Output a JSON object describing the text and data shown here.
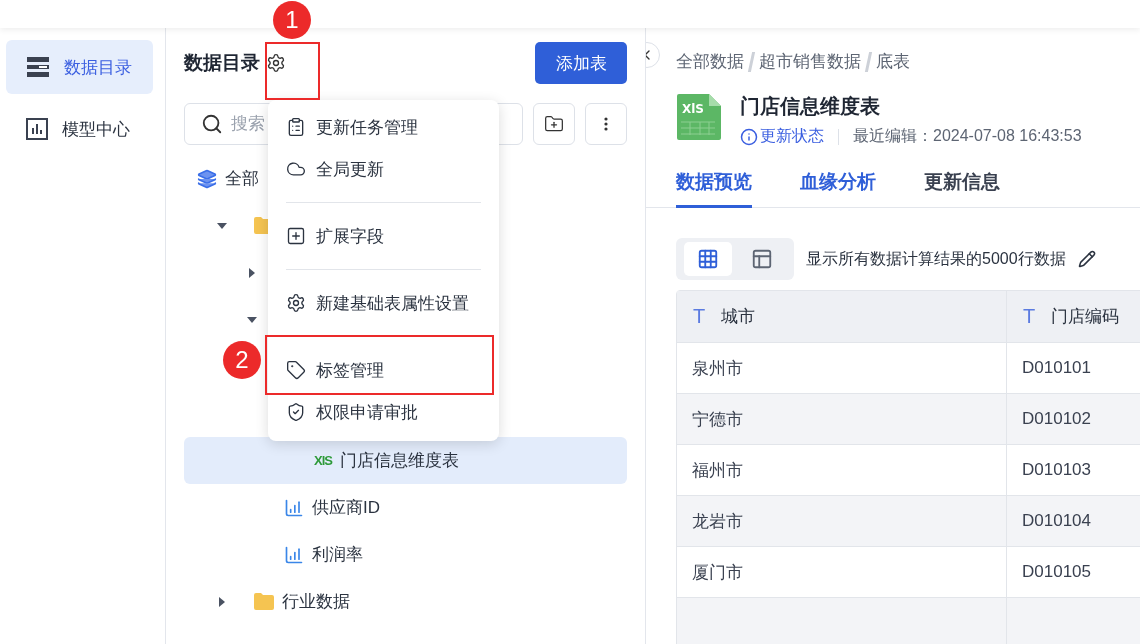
{
  "nav": {
    "items": [
      {
        "label": "数据目录",
        "kind": "catalog",
        "selected": true
      },
      {
        "label": "模型中心",
        "kind": "model",
        "selected": false
      }
    ]
  },
  "catalog": {
    "title": "数据目录",
    "add_button": "添加表",
    "search": {
      "placeholder": "搜索"
    },
    "tree": [
      {
        "label": "全部",
        "kind": "root",
        "selected": false,
        "children": [
          {
            "kind": "folder",
            "selected": false,
            "expanded": true,
            "children": [
              {
                "kind": "group",
                "selected": false,
                "expanded": false
              },
              {
                "kind": "group",
                "selected": false,
                "expanded": true,
                "children": [
                  {
                    "label": "门店信息维度表",
                    "kind": "xls",
                    "icon_text": "XlS",
                    "selected": true
                  }
                ]
              },
              {
                "label": "供应商ID",
                "kind": "metric",
                "selected": false
              },
              {
                "label": "利润率",
                "kind": "metric",
                "selected": false
              }
            ]
          },
          {
            "label": "行业数据",
            "kind": "folder",
            "selected": false,
            "expanded": false
          }
        ]
      }
    ]
  },
  "menu": {
    "groups": [
      [
        {
          "label": "更新任务管理",
          "kind": "tasks"
        },
        {
          "label": "全局更新",
          "kind": "refresh"
        }
      ],
      [
        {
          "label": "扩展字段",
          "kind": "extend"
        }
      ],
      [
        {
          "label": "新建基础表属性设置",
          "kind": "settings"
        }
      ],
      [
        {
          "label": "标签管理",
          "kind": "tag"
        },
        {
          "label": "权限申请审批",
          "kind": "permission"
        }
      ]
    ]
  },
  "annotations": [
    {
      "number": "1"
    },
    {
      "number": "2"
    }
  ],
  "detail": {
    "breadcrumbs": [
      "全部数据",
      "超市销售数据",
      "底表"
    ],
    "file_badge": "XlS",
    "title": "门店信息维度表",
    "status_link": "更新状态",
    "edited": "最近编辑：2024-07-08 16:43:53",
    "tabs": [
      {
        "label": "数据预览",
        "selected": true
      },
      {
        "label": "血缘分析",
        "selected": false
      },
      {
        "label": "更新信息",
        "selected": false
      }
    ],
    "views": [
      {
        "kind": "grid",
        "selected": true
      },
      {
        "kind": "layout",
        "selected": false
      }
    ],
    "note": "显示所有数据计算结果的5000行数据",
    "table": {
      "columns": [
        {
          "type_mark": "T",
          "label": "城市"
        },
        {
          "type_mark": "T",
          "label": "门店编码"
        }
      ],
      "rows": [
        [
          "泉州市",
          "D010101"
        ],
        [
          "宁德市",
          "D010102"
        ],
        [
          "福州市",
          "D010103"
        ],
        [
          "龙岩市",
          "D010104"
        ],
        [
          "厦门市",
          "D010105"
        ],
        [
          "",
          ""
        ]
      ]
    }
  }
}
